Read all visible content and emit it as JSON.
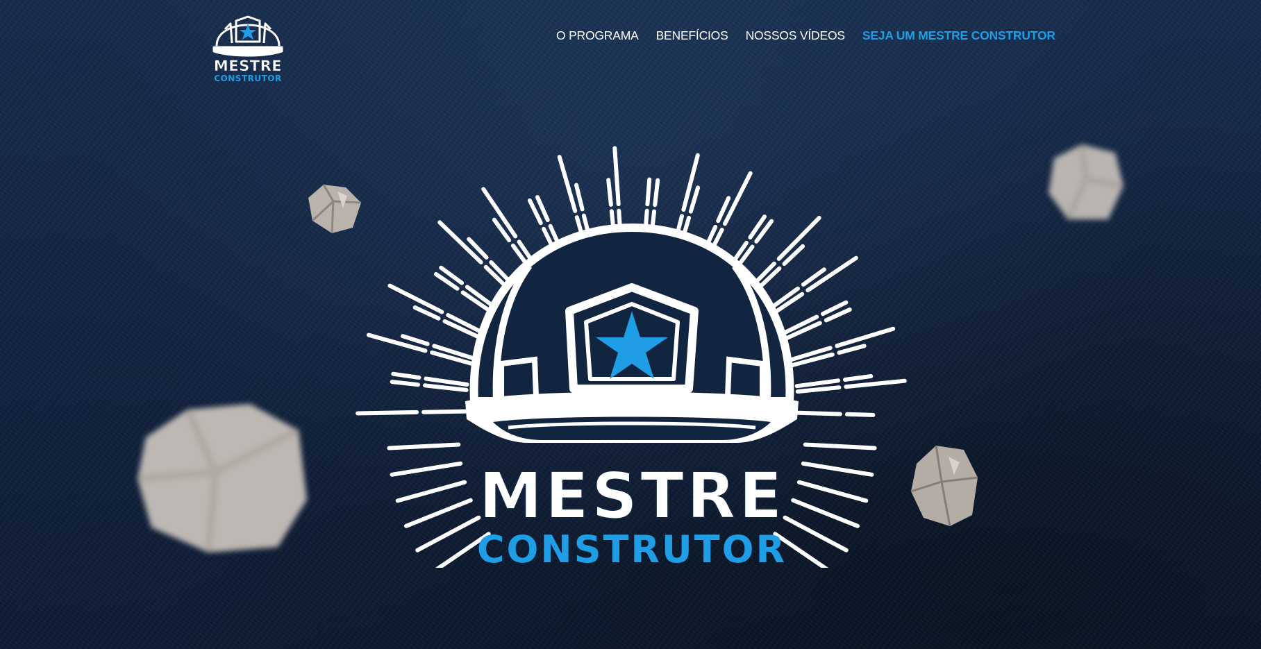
{
  "brand": {
    "name_line1": "MESTRE",
    "name_line2": "CONSTRUTOR"
  },
  "nav": {
    "items": [
      {
        "label": "O PROGRAMA"
      },
      {
        "label": "BENEFÍCIOS"
      },
      {
        "label": "NOSSOS VÍDEOS"
      },
      {
        "label": "SEJA UM MESTRE CONSTRUTOR"
      }
    ]
  },
  "hero": {
    "logo_line1": "MESTRE",
    "logo_line2": "CONSTRUTOR"
  },
  "icons": {
    "helmet": "helmet-star-icon",
    "rocks": "rock-image"
  },
  "colors": {
    "background": "#112440",
    "accent": "#1f9ee6",
    "text": "#ffffff"
  }
}
